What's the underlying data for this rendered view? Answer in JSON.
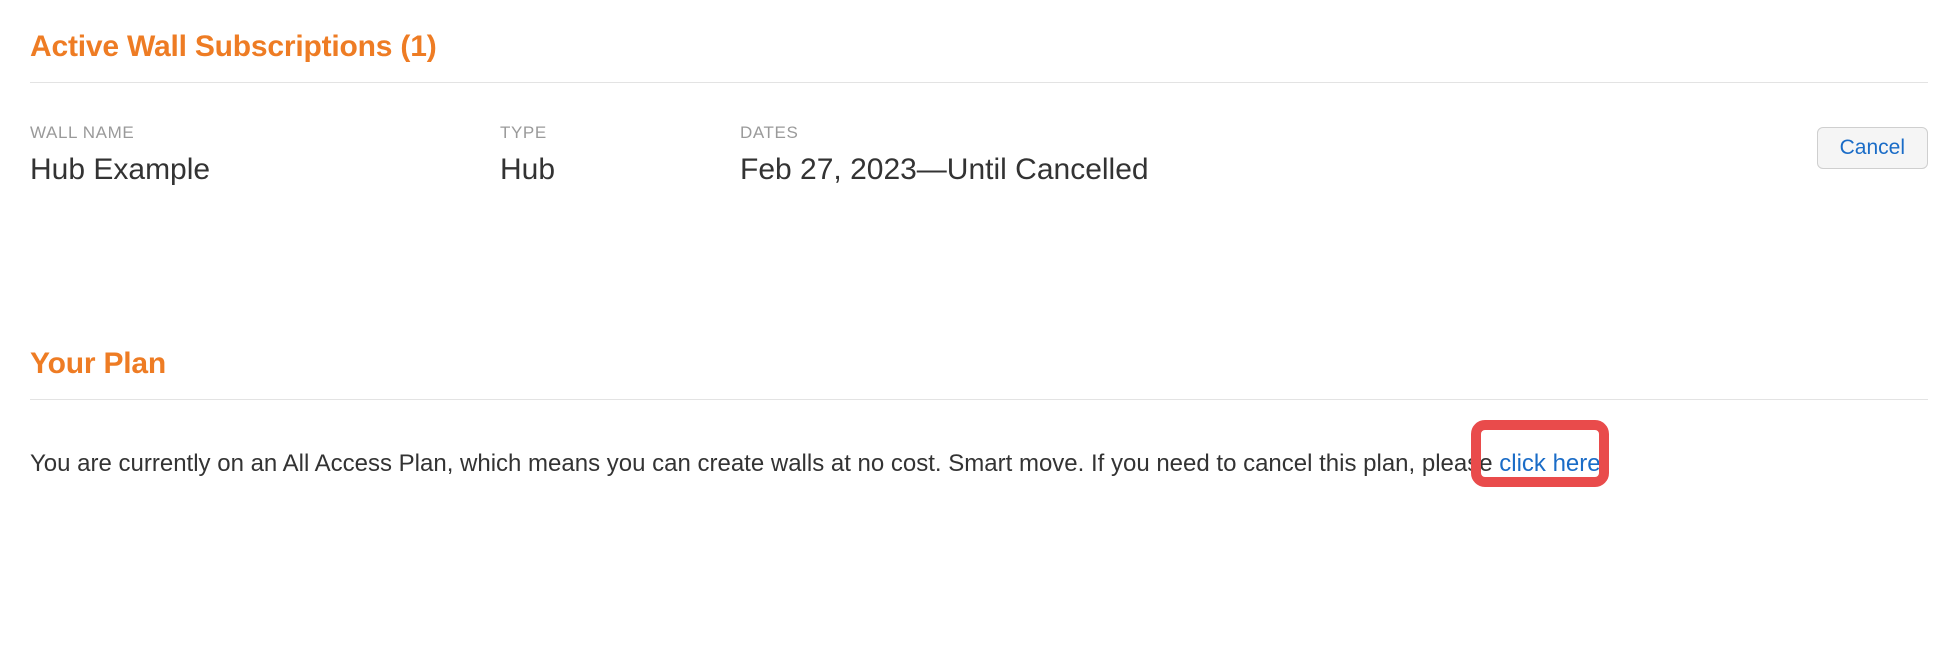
{
  "subscriptions": {
    "heading": "Active Wall Subscriptions (1)",
    "columns": {
      "wall_name": "WALL NAME",
      "type": "TYPE",
      "dates": "DATES"
    },
    "row": {
      "wall_name": "Hub Example",
      "type": "Hub",
      "dates": "Feb 27, 2023—Until Cancelled"
    },
    "cancel_button": "Cancel"
  },
  "plan": {
    "heading": "Your Plan",
    "text_before": "You are currently on an All Access Plan, which means you can create walls at no cost. Smart move. If you need to cancel this plan, please ",
    "link_text": "click here",
    "text_after": "."
  }
}
